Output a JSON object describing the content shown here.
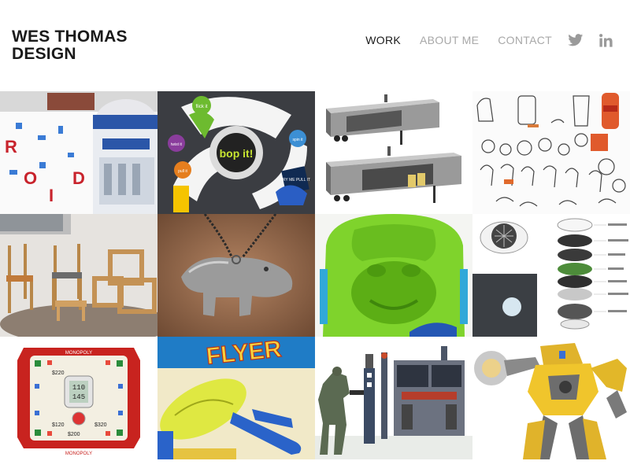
{
  "site": {
    "title_line1": "WES THOMAS",
    "title_line2": "DESIGN"
  },
  "nav": {
    "items": [
      {
        "label": "WORK",
        "active": true
      },
      {
        "label": "ABOUT ME",
        "active": false
      },
      {
        "label": "CONTACT",
        "active": false
      }
    ],
    "social": [
      "twitter-icon",
      "linkedin-icon"
    ]
  },
  "colors": {
    "text_dark": "#1a1a1a",
    "nav_inactive": "#a8a8a8",
    "social_icon": "#9a9a9a",
    "background": "#ffffff"
  },
  "tiles": {
    "droid": {
      "letters": [
        "R",
        "O",
        "I",
        "D"
      ]
    },
    "bopit": {
      "center_text": "bop it!",
      "labels": [
        "flick it",
        "twist it",
        "spin it",
        "pull it",
        "TRY ME PULL IT"
      ]
    },
    "boardgame": {
      "center_line1": "110",
      "center_line2": "145",
      "labels": [
        "MONOPOLY",
        "$120",
        "$200",
        "$320",
        "$220"
      ]
    },
    "football": {
      "title": "FLYER"
    }
  }
}
